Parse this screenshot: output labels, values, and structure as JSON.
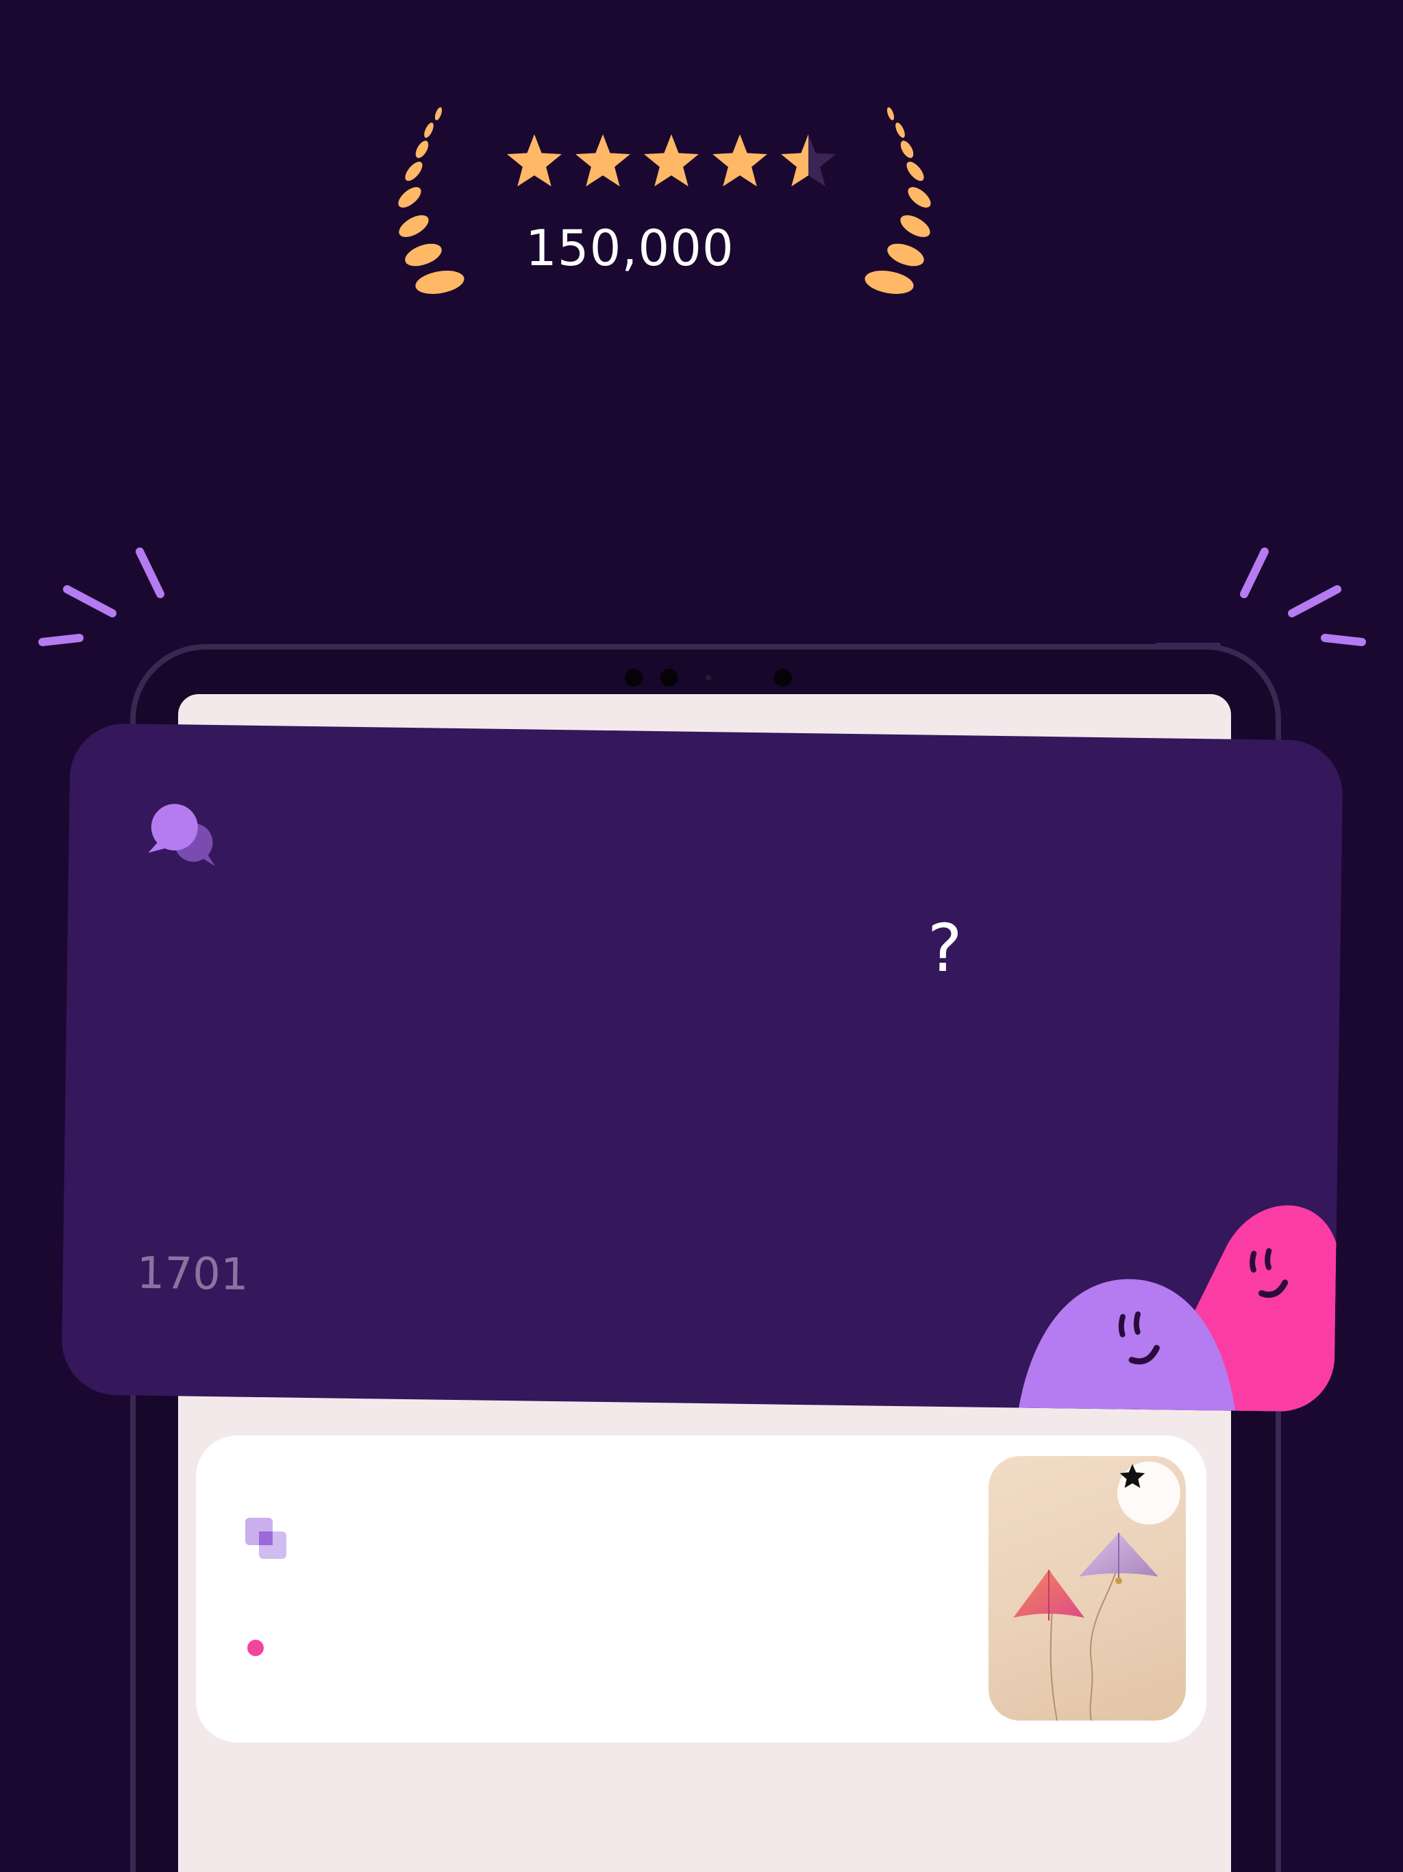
{
  "rating": {
    "stars": 4.5,
    "max_stars": 5,
    "review_count": "150,000",
    "star_color": "#ffb866",
    "laurel_color": "#ffb866"
  },
  "prompt_card": {
    "question": "?",
    "number": "1701",
    "icon": "chat-bubbles-icon",
    "background": "#35175c",
    "characters": [
      "purple-blob-character",
      "pink-blob-character"
    ]
  },
  "content_card": {
    "icon": "layers-icon",
    "status_dot_color": "#f0459e",
    "thumbnail": "kites-image",
    "favorite_icon": "star-icon"
  },
  "colors": {
    "background": "#1a0830",
    "accent_purple": "#b47cf0",
    "accent_pink": "#fb3ca4",
    "screen": "#f3e9eb"
  }
}
